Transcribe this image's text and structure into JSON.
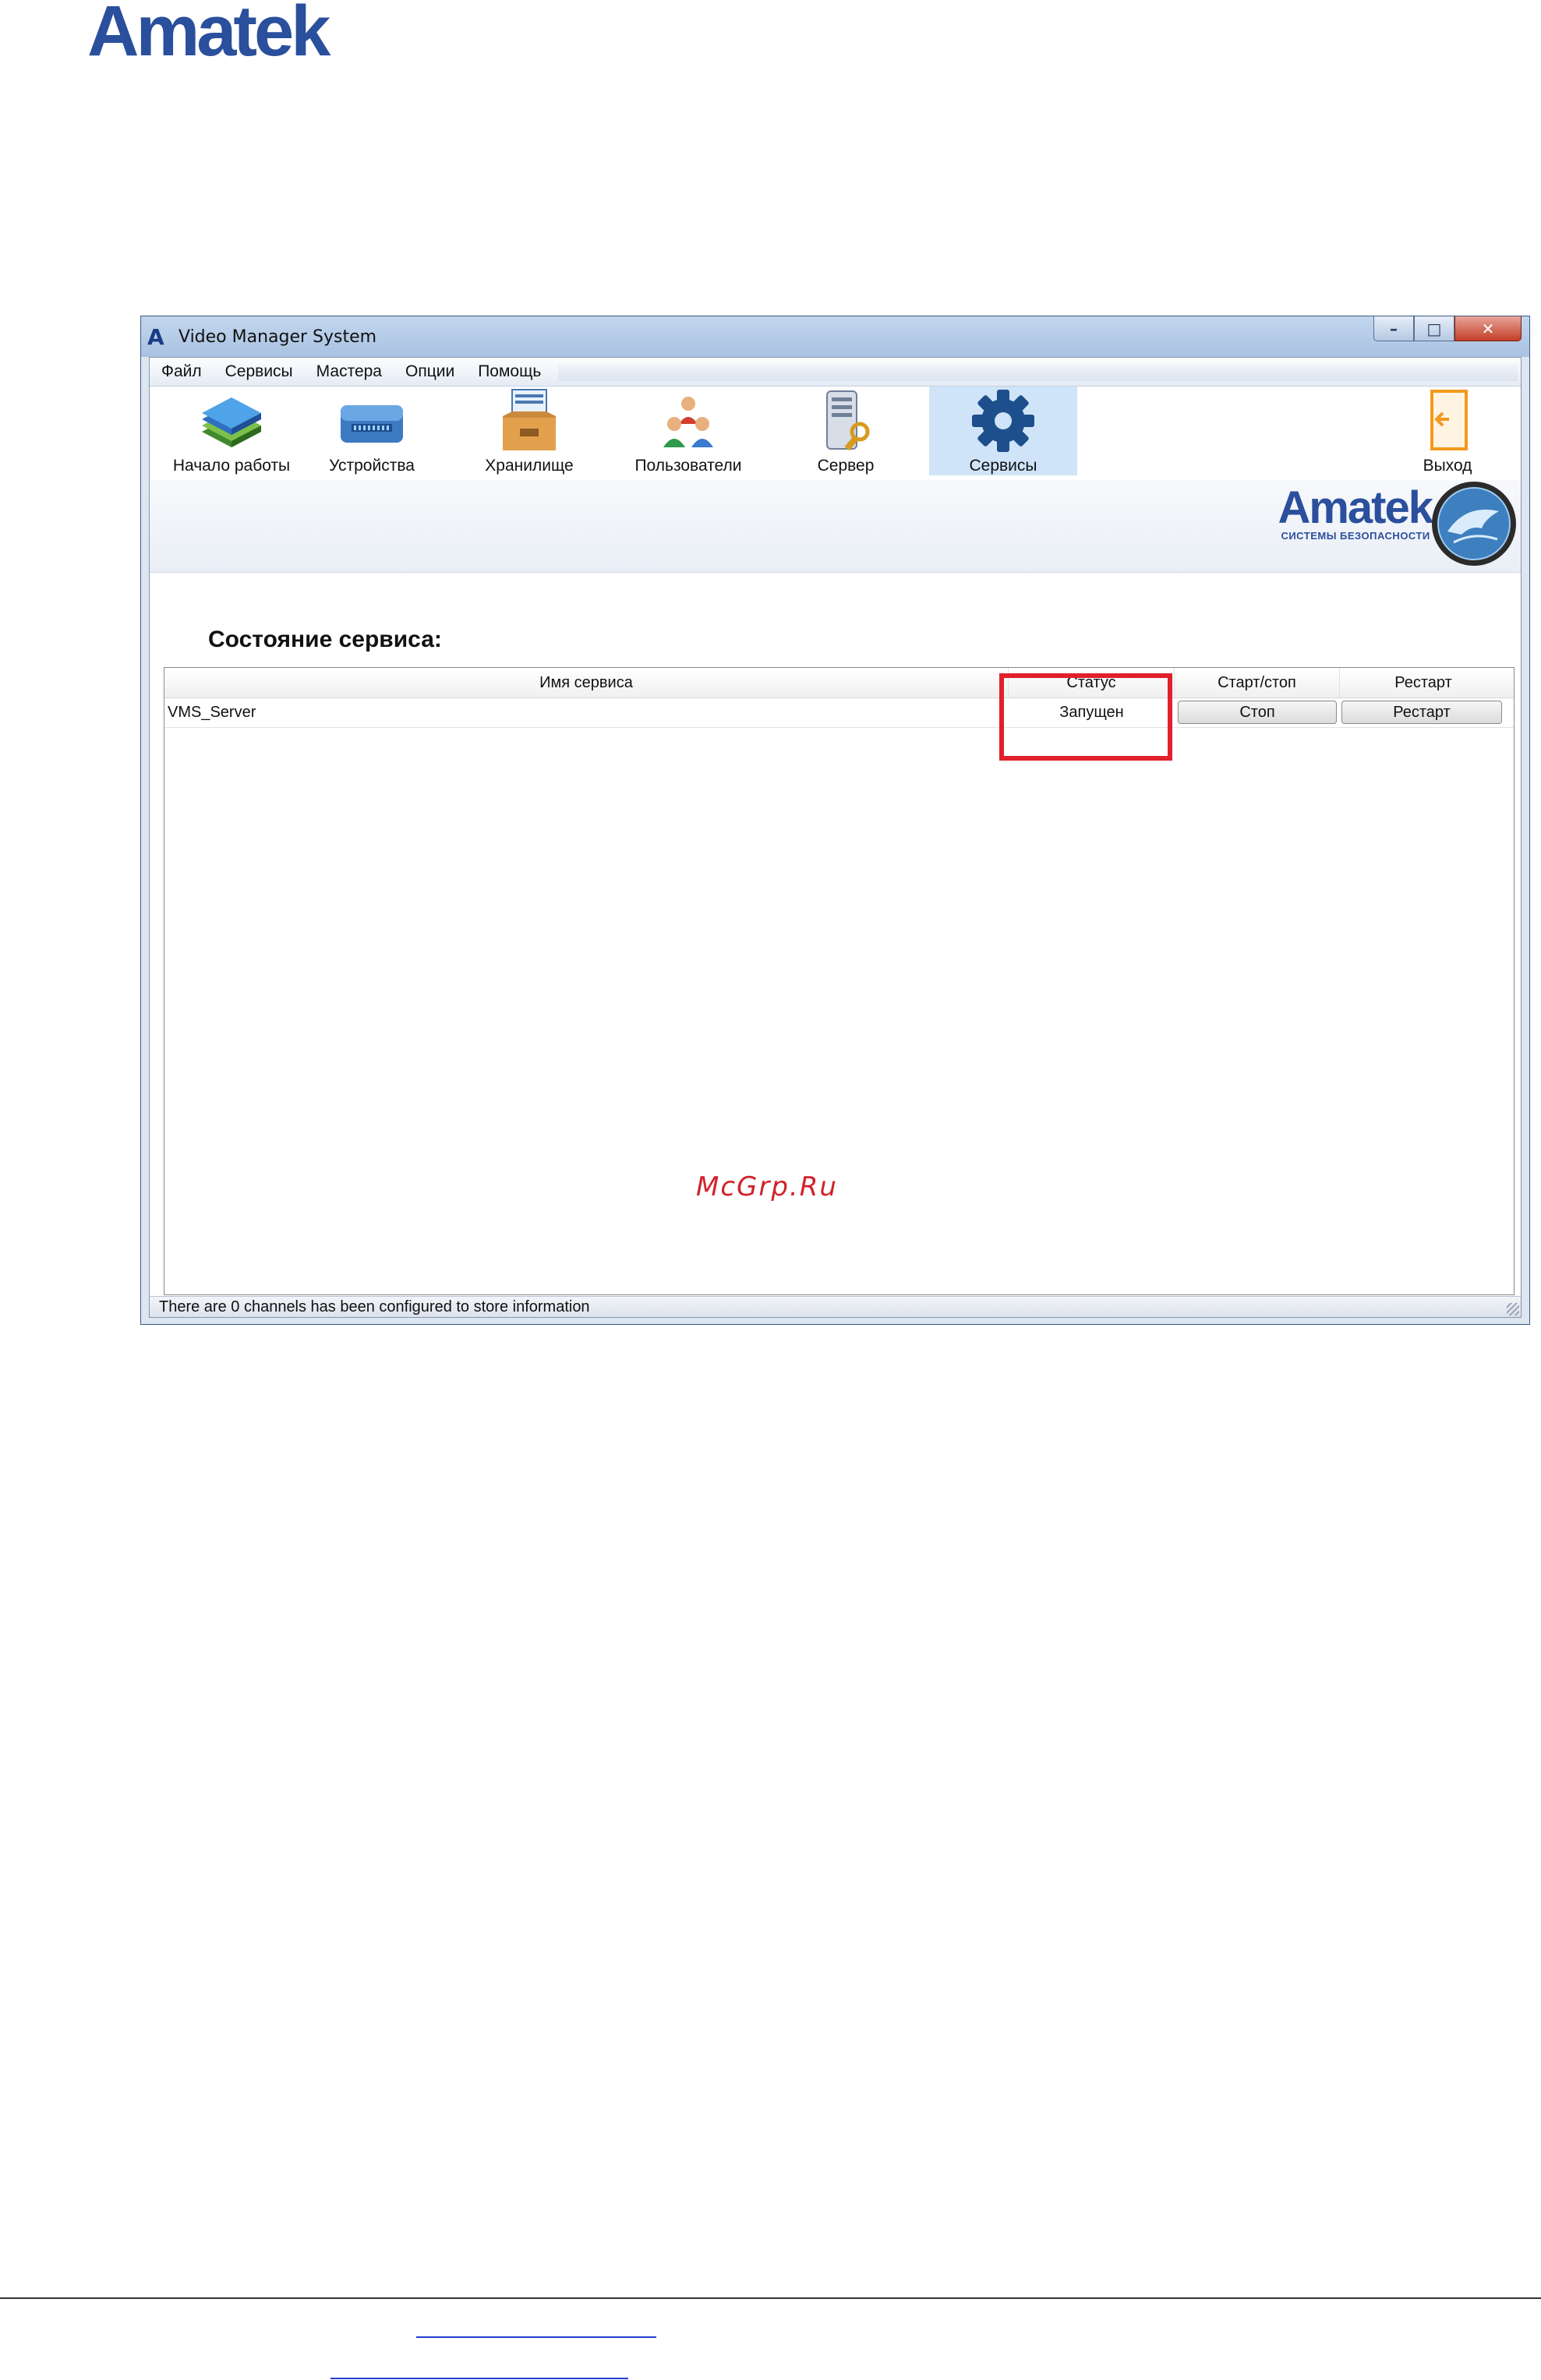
{
  "document": {
    "header_logo": "Amatek",
    "watermark": "McGrp.Ru"
  },
  "window": {
    "title": "Video Manager System",
    "title_icon": "A",
    "controls": {
      "minimize": "–",
      "maximize": "□",
      "close": "✕"
    }
  },
  "menu": [
    "Файл",
    "Сервисы",
    "Мастера",
    "Опции",
    "Помощь"
  ],
  "toolbar": [
    {
      "label": "Начало работы",
      "icon": "books-icon"
    },
    {
      "label": "Устройства",
      "icon": "dvr-device-icon"
    },
    {
      "label": "Хранилище",
      "icon": "storage-tray-icon"
    },
    {
      "label": "Пользователи",
      "icon": "users-icon"
    },
    {
      "label": "Сервер",
      "icon": "server-key-icon"
    },
    {
      "label": "Сервисы",
      "icon": "gear-icon",
      "active": true
    },
    {
      "label": "Выход",
      "icon": "exit-door-icon"
    }
  ],
  "banner": {
    "brand": "Amatek",
    "tagline": "СИСТЕМЫ БЕЗОПАСНОСТИ"
  },
  "page": {
    "title": "Состояние сервиса:"
  },
  "table": {
    "columns": [
      "Имя сервиса",
      "Статус",
      "Старт/стоп",
      "Рестарт"
    ],
    "rows": [
      {
        "name": "VMS_Server",
        "status": "Запущен",
        "start_stop": "Стоп",
        "restart": "Рестарт"
      }
    ]
  },
  "status_bar": {
    "text": "There are 0 channels has been configured to store information"
  },
  "colors": {
    "brand_blue": "#2a4f9c",
    "highlight_red": "#e0202a",
    "active_tool_bg": "#cfe4f8"
  }
}
